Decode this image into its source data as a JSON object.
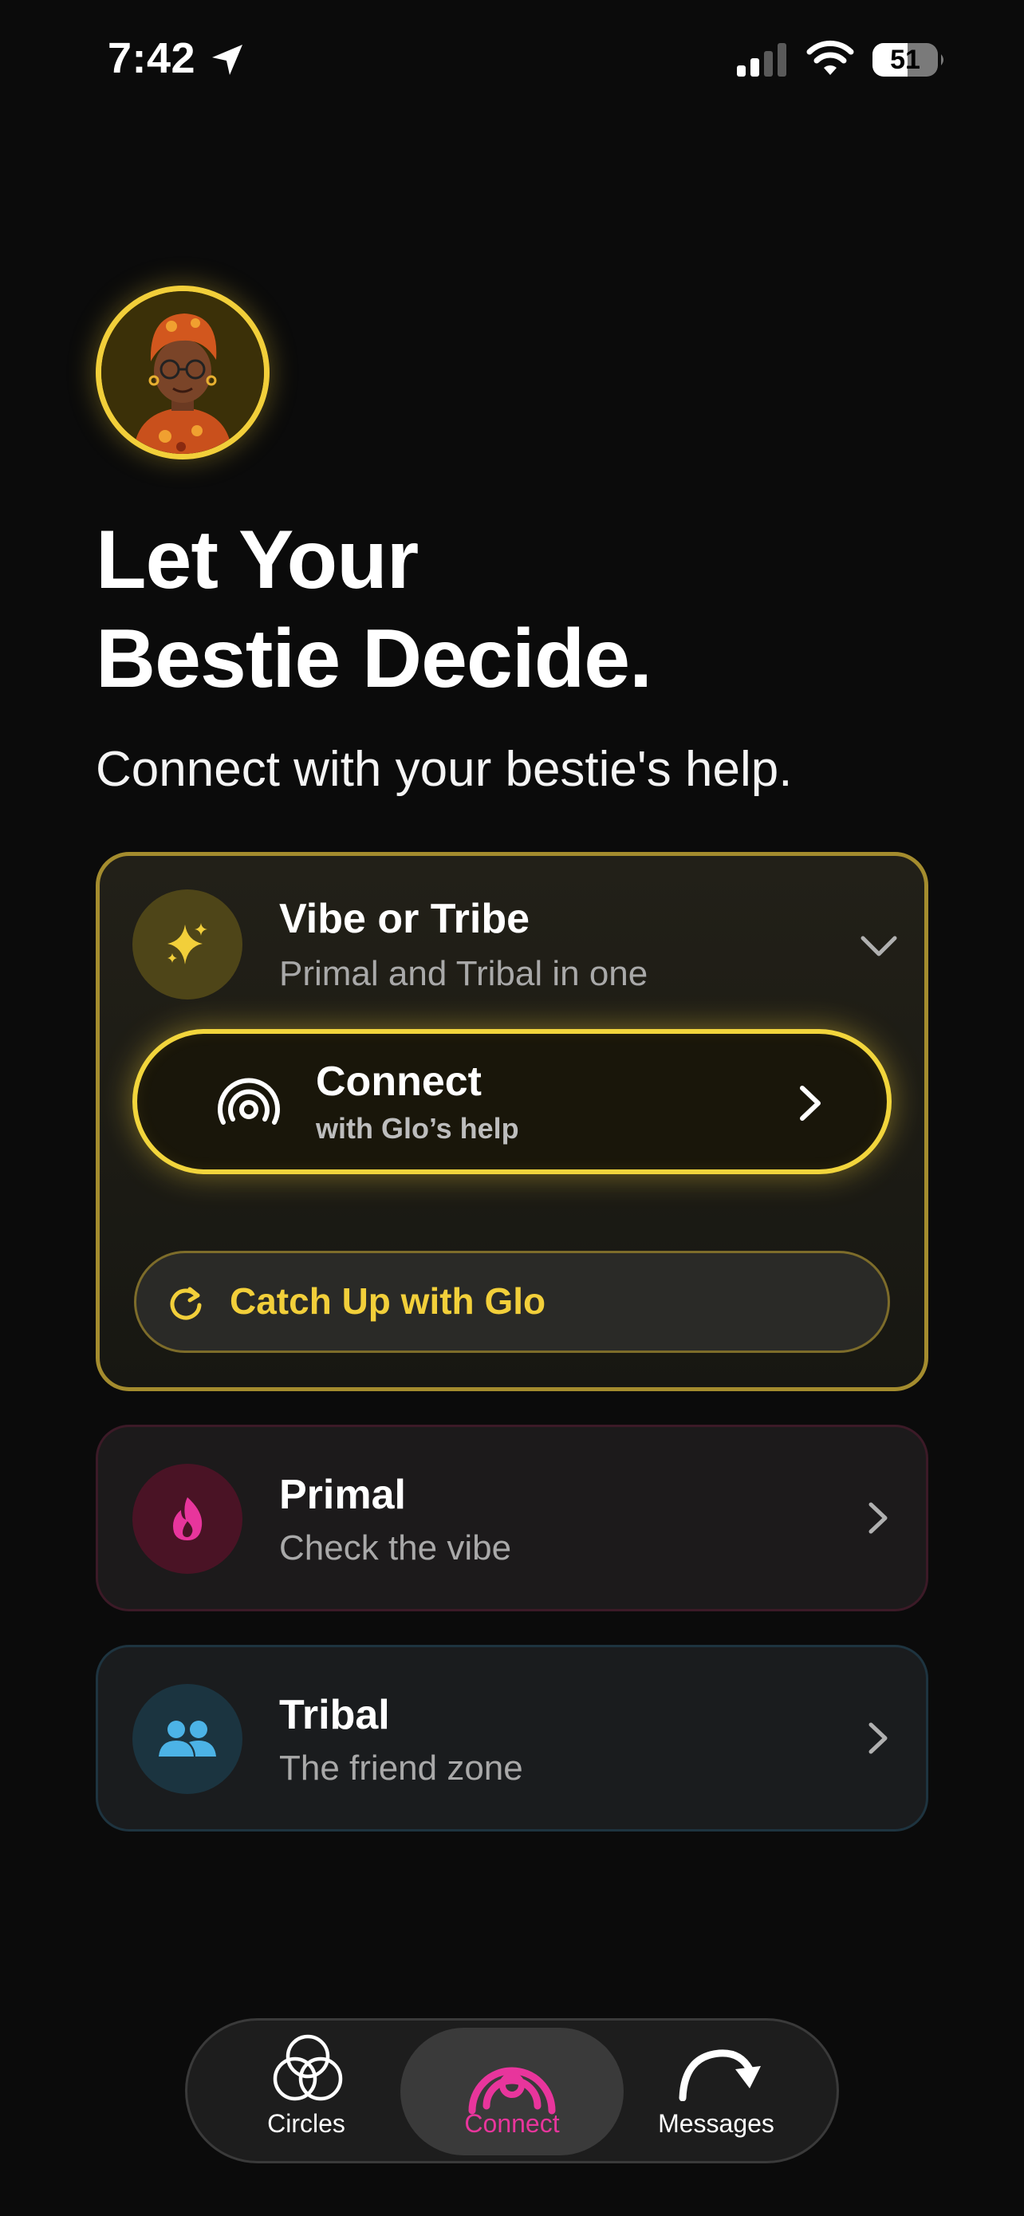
{
  "status_bar": {
    "time": "7:42",
    "battery": "51"
  },
  "header": {
    "title_line1": "Let Your",
    "title_line2": "Bestie Decide.",
    "subtitle": "Connect with your bestie's help."
  },
  "vibe_card": {
    "icon": "sparkles-icon",
    "title": "Vibe or Tribe",
    "subtitle": "Primal and Tribal in one",
    "connect_button": {
      "title": "Connect",
      "subtitle": "with Glo’s help",
      "icon": "radar-icon"
    },
    "catchup_button": {
      "label": "Catch Up with Glo",
      "icon": "refresh-icon"
    }
  },
  "primal_card": {
    "icon": "flame-icon",
    "title": "Primal",
    "subtitle": "Check the vibe"
  },
  "tribal_card": {
    "icon": "people-icon",
    "title": "Tribal",
    "subtitle": "The friend zone"
  },
  "tab_bar": {
    "tabs": [
      {
        "label": "Circles",
        "icon": "circles-icon",
        "active": false
      },
      {
        "label": "Connect",
        "icon": "radar-icon",
        "active": true
      },
      {
        "label": "Messages",
        "icon": "forward-arrow-icon",
        "active": false
      }
    ]
  },
  "colors": {
    "accent_yellow": "#f2cf3a",
    "primal_pink": "#e8359c",
    "tribal_blue": "#4cb3e6",
    "background": "#0b0b0b"
  }
}
